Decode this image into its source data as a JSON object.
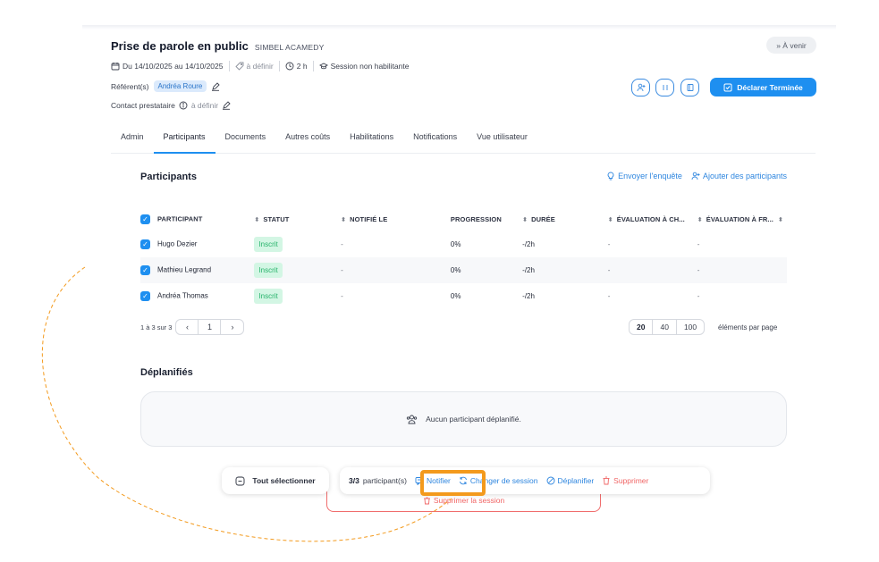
{
  "session": {
    "title": "Prise de parole en public",
    "organization": "SIMBEL ACAMEDY",
    "status_label": "» À venir",
    "dates": "Du 14/10/2025 au 14/10/2025",
    "location": "à définir",
    "duration": "2 h",
    "qualification": "Session non habilitante",
    "referent_label": "Référent(s)",
    "referent_name": "Andréa Roure",
    "contact_label": "Contact prestataire",
    "contact_value": "à définir",
    "declare_button": "Déclarer Terminée"
  },
  "tabs": [
    "Admin",
    "Participants",
    "Documents",
    "Autres coûts",
    "Habilitations",
    "Notifications",
    "Vue utilisateur"
  ],
  "active_tab": "Participants",
  "participants": {
    "title": "Participants",
    "send_survey": "Envoyer l'enquête",
    "add_participants": "Ajouter des participants",
    "columns": [
      "PARTICIPANT",
      "STATUT",
      "NOTIFIÉ LE",
      "PROGRESSION",
      "DURÉE",
      "ÉVALUATION À CH...",
      "ÉVALUATION À FR..."
    ],
    "rows": [
      {
        "name": "Hugo Dezier",
        "status": "Inscrit",
        "notified": "-",
        "progress": "0%",
        "duration": "-/2h",
        "eval_hot": "-",
        "eval_cold": "-"
      },
      {
        "name": "Mathieu Legrand",
        "status": "Inscrit",
        "notified": "-",
        "progress": "0%",
        "duration": "-/2h",
        "eval_hot": "-",
        "eval_cold": "-"
      },
      {
        "name": "Andréa Thomas",
        "status": "Inscrit",
        "notified": "-",
        "progress": "0%",
        "duration": "-/2h",
        "eval_hot": "-",
        "eval_cold": "-"
      }
    ],
    "range_text": "1 à 3 sur 3",
    "current_page": "1",
    "page_sizes": [
      "20",
      "40",
      "100"
    ],
    "selected_page_size": "20",
    "per_page_label": "éléments par page"
  },
  "unplanned": {
    "title": "Déplanifiés",
    "empty_text": "Aucun participant déplanifié."
  },
  "bulk_bar": {
    "select_all": "Tout sélectionner",
    "count": "3/3",
    "count_label": "participant(s)",
    "notify": "Notifier",
    "change_session": "Changer de session",
    "unplan": "Déplanifier",
    "delete": "Supprimer",
    "delete_session": "Supprimer la session"
  },
  "colors": {
    "accent": "#1e8ff0",
    "highlight": "#f39a1d",
    "danger": "#f06565",
    "badge_bg": "#d3f6e4",
    "badge_text": "#27b36b"
  }
}
